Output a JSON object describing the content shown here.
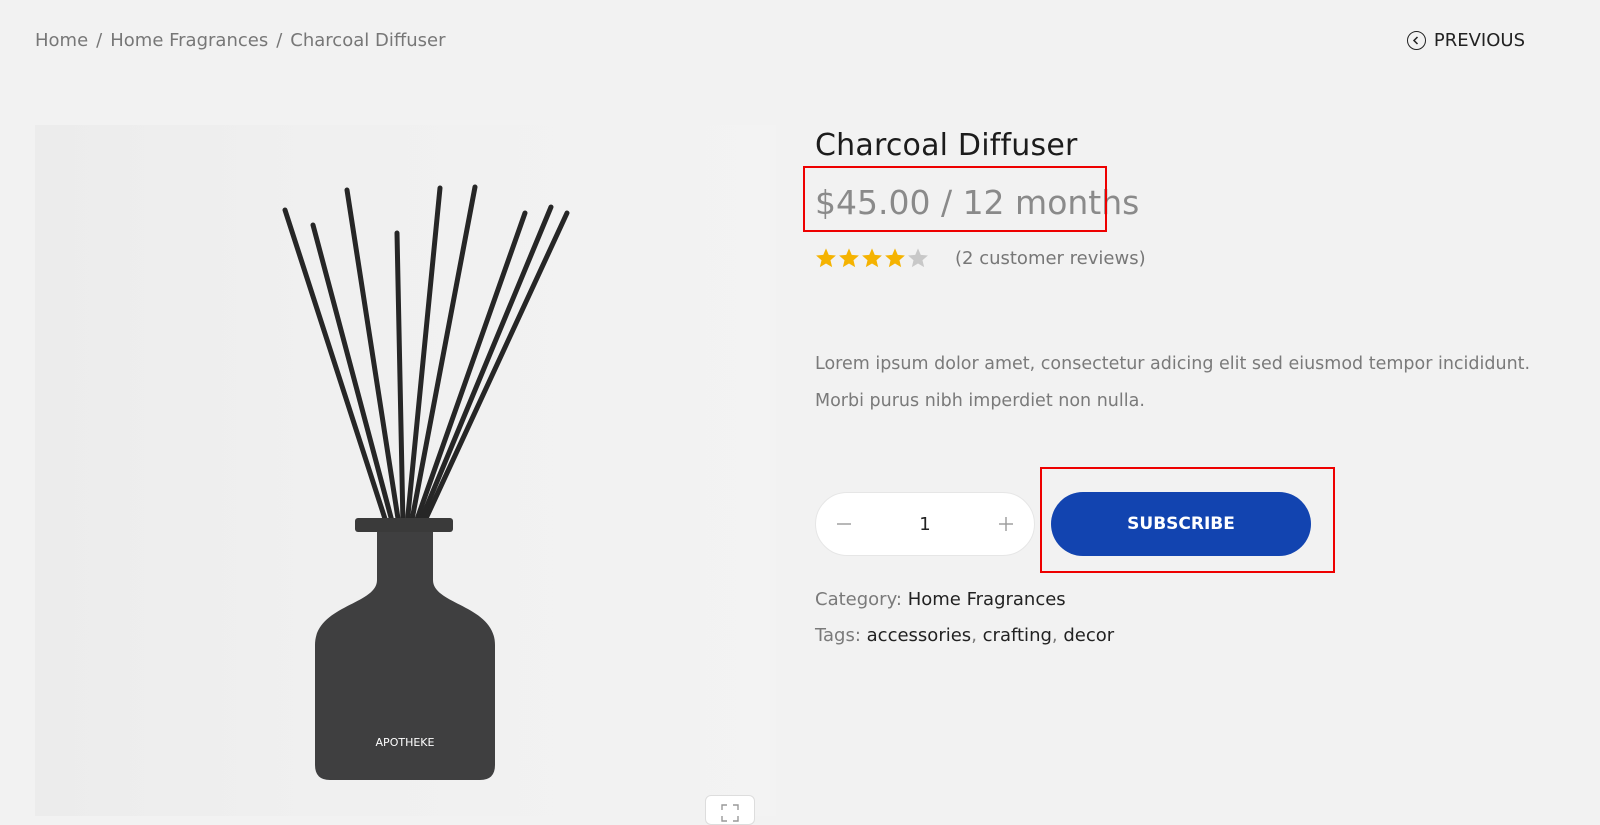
{
  "breadcrumb": {
    "items": [
      "Home",
      "Home Fragrances",
      "Charcoal Diffuser"
    ],
    "separator": "/"
  },
  "nav": {
    "previous_label": "PREVIOUS"
  },
  "product": {
    "title": "Charcoal Diffuser",
    "price": "$45.00 / 12 months",
    "rating_value": 4,
    "rating_max": 5,
    "reviews_text": "(2 customer reviews)",
    "description_line1": "Lorem ipsum dolor amet, consectetur adicing elit sed eiusmod tempor incididunt.",
    "description_line2": "Morbi purus nibh imperdiet non nulla.",
    "quantity": "1",
    "subscribe_label": "SUBSCRIBE",
    "bottle_label": "APOTHEKE",
    "category_label": "Category:",
    "category_value": "Home Fragrances",
    "tags_label": "Tags:",
    "tags": [
      "accessories",
      "crafting",
      "decor"
    ],
    "tag_separator": ","
  },
  "colors": {
    "accent": "#1244b0",
    "star_filled": "#f5b301",
    "star_empty": "#c8c8c8",
    "highlight": "#e00000"
  }
}
